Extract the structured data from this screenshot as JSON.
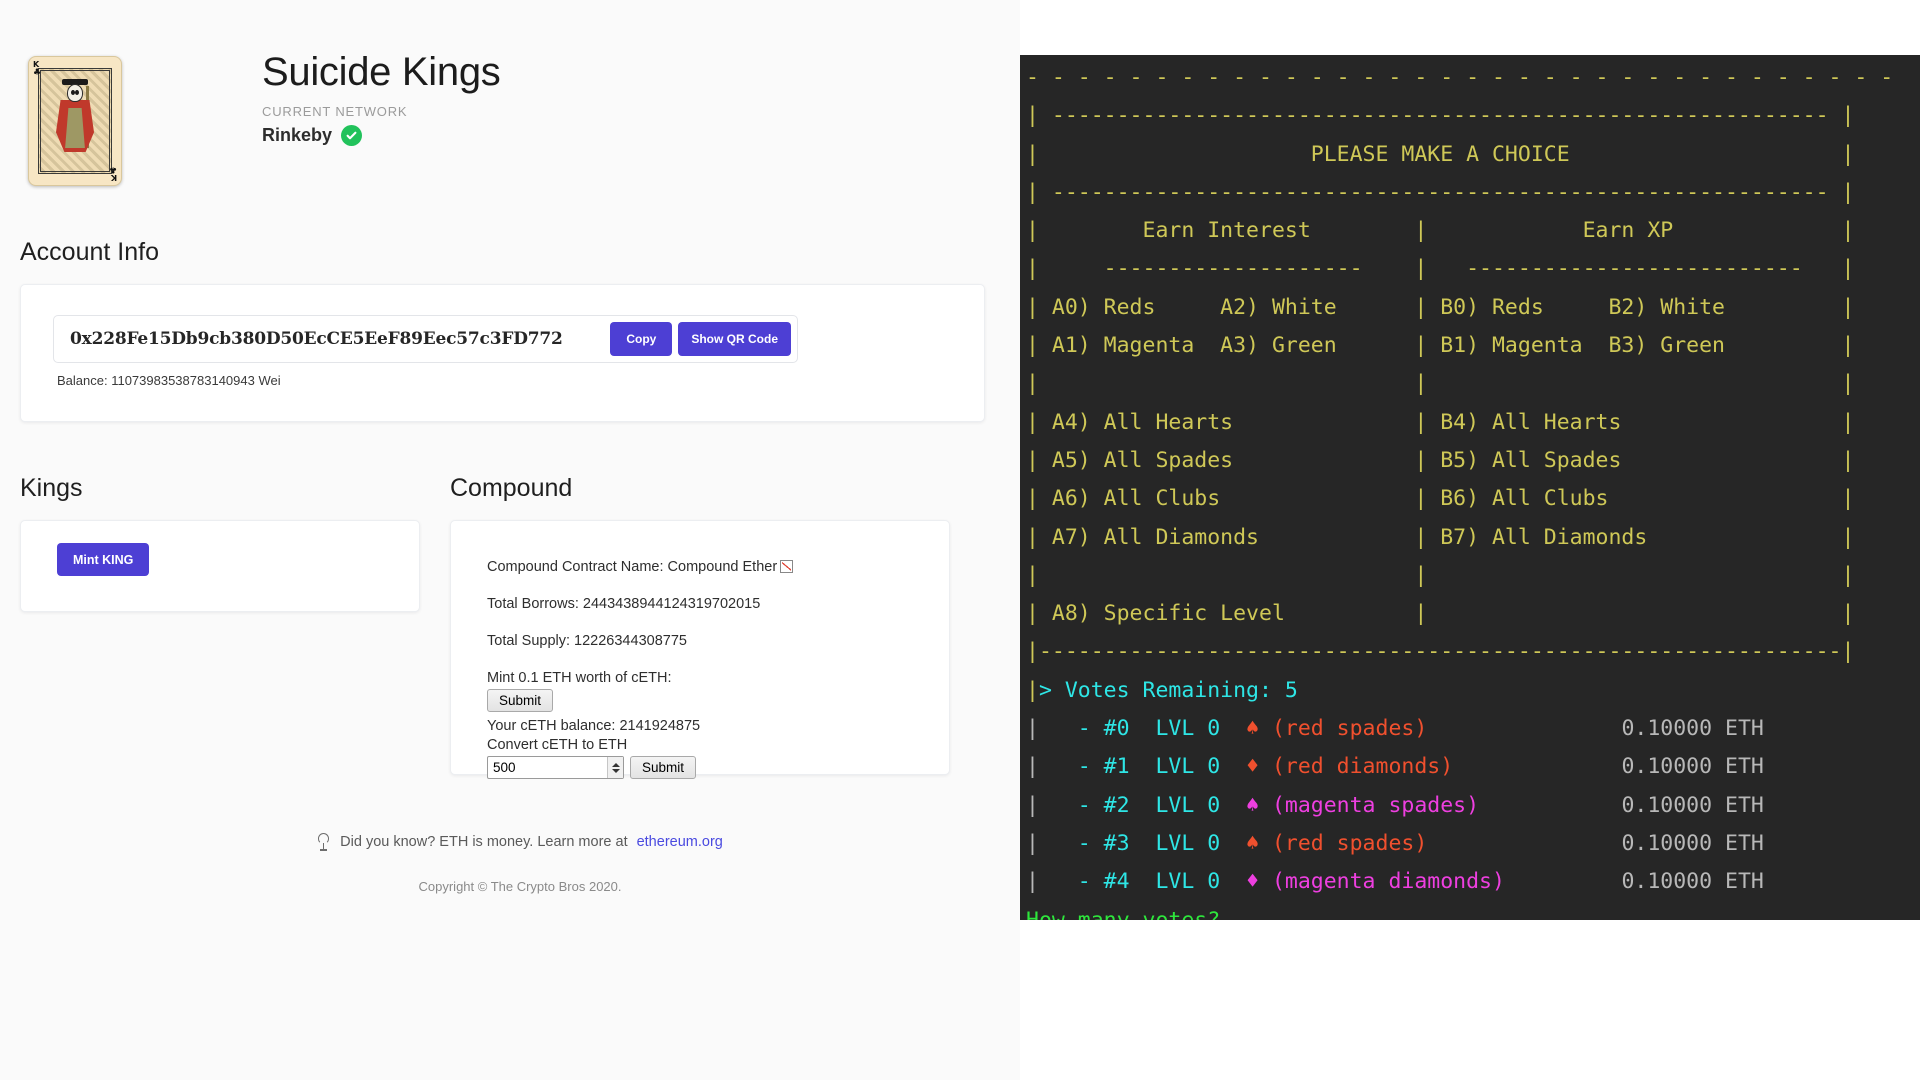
{
  "app": {
    "title": "Suicide Kings",
    "network_label": "CURRENT NETWORK",
    "network_name": "Rinkeby",
    "card_rank": "K",
    "card_suit": "♣"
  },
  "account": {
    "heading": "Account Info",
    "address": "0x228Fe15Db9cb380D50EcCE5EeF89Eec57c3FD772",
    "copy_label": "Copy",
    "qr_label": "Show QR Code",
    "balance": "Balance: 11073983538783140943 Wei"
  },
  "kings": {
    "heading": "Kings",
    "mint_label": "Mint KING"
  },
  "compound": {
    "heading": "Compound",
    "contract_name": "Compound Contract Name: Compound Ether",
    "total_borrows": "Total Borrows: 24434389441243197020​15",
    "total_supply": "Total Supply: 12226344308775",
    "mint_label": "Mint 0.1 ETH worth of cETH:",
    "mint_submit": "Submit",
    "ceth_balance": "Your cETH balance: 2141924875",
    "convert_label": "Convert cETH to ETH",
    "convert_value": "500",
    "convert_submit": "Submit"
  },
  "footer": {
    "tip_text": "Did you know? ETH is money. Learn more at",
    "tip_link": "ethereum.org",
    "copyright": "Copyright © The Crypto Bros 2020."
  },
  "terminal": {
    "rule_top": "- - - - - - - - - - - - - - - - - - - - - - - - - - - - - - - - - -",
    "border_v": "|",
    "rule_inner": "-------------------------------------------------",
    "header": "PLEASE MAKE A CHOICE",
    "col_a_title": "Earn Interest",
    "col_b_title": "Earn XP",
    "col_a_rule": "--------------------",
    "col_b_rule": "--------------------------",
    "rows": [
      {
        "a_left": "A0) Reds",
        "a_right": "A2) White",
        "b_left": "B0) Reds",
        "b_right": "B2) White"
      },
      {
        "a_left": "A1) Magenta",
        "a_right": "A3) Green",
        "b_left": "B1) Magenta",
        "b_right": "B3) Green"
      }
    ],
    "group_rows": [
      {
        "a": "A4) All Hearts",
        "b": "B4) All Hearts"
      },
      {
        "a": "A5) All Spades",
        "b": "B5) All Spades"
      },
      {
        "a": "A6) All Clubs",
        "b": "B6) All Clubs"
      },
      {
        "a": "A7) All Diamonds",
        "b": "B7) All Diamonds"
      }
    ],
    "specific_level": "A8) Specific Level",
    "votes_remaining": "> Votes Remaining: 5",
    "votes": [
      {
        "id": "#0",
        "lvl": "LVL 0",
        "suit": "♠",
        "desc": "(red spades)",
        "color": "rd",
        "amount": "0.10000 ETH"
      },
      {
        "id": "#1",
        "lvl": "LVL 0",
        "suit": "♦",
        "desc": "(red diamonds)",
        "color": "rd",
        "amount": "0.10000 ETH"
      },
      {
        "id": "#2",
        "lvl": "LVL 0",
        "suit": "♠",
        "desc": "(magenta spades)",
        "color": "mg",
        "amount": "0.10000 ETH"
      },
      {
        "id": "#3",
        "lvl": "LVL 0",
        "suit": "♠",
        "desc": "(red spades)",
        "color": "rd",
        "amount": "0.10000 ETH"
      },
      {
        "id": "#4",
        "lvl": "LVL 0",
        "suit": "♦",
        "desc": "(magenta diamonds)",
        "color": "mg",
        "amount": "0.10000 ETH"
      }
    ],
    "prompt_question": "How many votes?",
    "prompt_symbol": ">"
  },
  "colors": {
    "accent_purple": "#4d3fd4",
    "terminal_bg": "#262626",
    "terminal_yellow": "#cfc857",
    "terminal_cyan": "#2ee6e6",
    "terminal_red": "#f0502e",
    "terminal_magenta": "#ee3fe0",
    "terminal_green": "#2ee63c",
    "badge_green": "#21c25b"
  }
}
